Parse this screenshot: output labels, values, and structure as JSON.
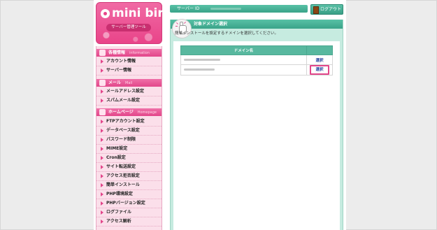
{
  "logo": {
    "brand": "mini bird",
    "tagline": "サーバー管理ツール"
  },
  "sidebar": {
    "categories": [
      {
        "label": "各種情報",
        "label_en": "information",
        "icon": "info-icon",
        "items": [
          "アカウント情報",
          "サーバー情報"
        ]
      },
      {
        "label": "メール",
        "label_en": "Mail",
        "icon": "mail-icon",
        "items": [
          "メールアドレス設定",
          "スパムメール設定"
        ]
      },
      {
        "label": "ホームページ",
        "label_en": "Homepage",
        "icon": "homepage-icon",
        "items": [
          "FTPアカウント設定",
          "データベース設定",
          "パスワード制限",
          "MIME設定",
          "Cron設定",
          "サイト転送設定",
          "アクセス拒否設定",
          "簡単インストール",
          "PHP環境設定",
          "PHPバージョン設定",
          "ログファイル",
          "アクセス解析"
        ]
      }
    ]
  },
  "header": {
    "server_id_label": "サーバー ID",
    "logout_label": "ログアウト"
  },
  "panel": {
    "title": "対象ドメイン選択",
    "description": "簡単インストールを設定するドメインを選択してください。",
    "table": {
      "column_domain": "ドメイン名",
      "rows": [
        {
          "select_label": "選択",
          "highlighted": false
        },
        {
          "select_label": "選択",
          "highlighted": true
        }
      ]
    }
  },
  "colors": {
    "accent_pink": "#e2468a",
    "accent_green": "#3aa389",
    "panel_bg": "#c6ebe0",
    "menu_bg": "#fbdfea"
  }
}
